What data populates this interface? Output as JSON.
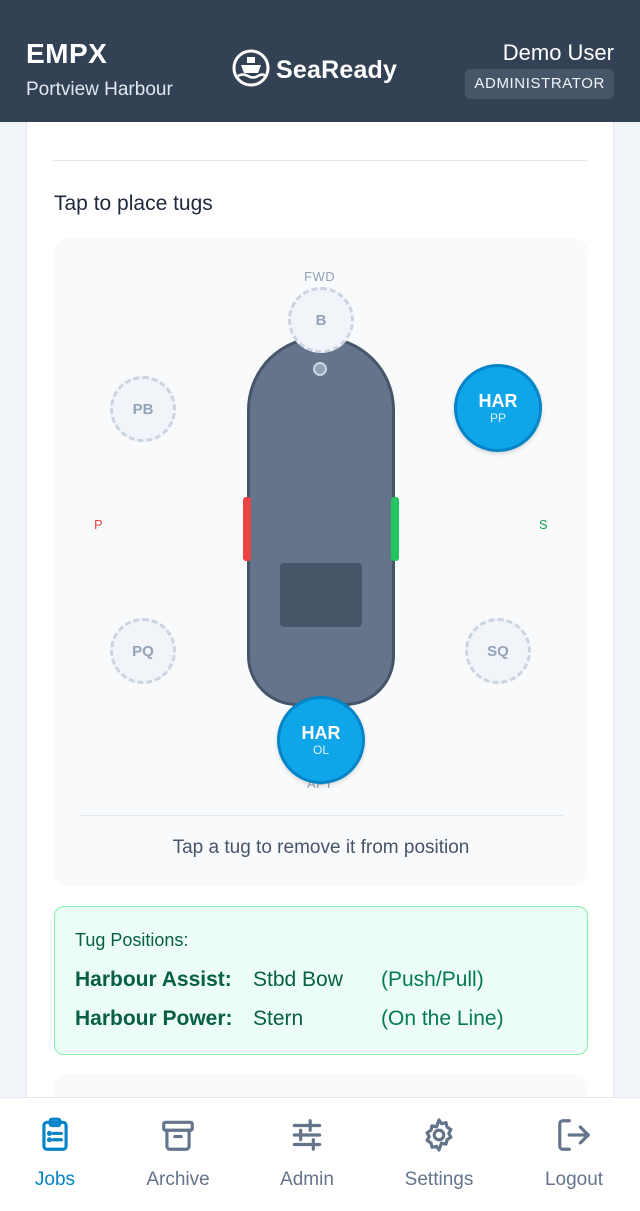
{
  "header": {
    "vessel_code": "EMPX",
    "port": "Portview Harbour",
    "brand": "SeaReady",
    "user_name": "Demo User",
    "user_role": "ADMINISTRATOR"
  },
  "section": {
    "title": "Tap to place tugs"
  },
  "diagram": {
    "fwd_label": "FWD",
    "aft_label": "AFT",
    "port_label": "P",
    "stbd_label": "S",
    "slots": {
      "b": "B",
      "pb": "PB",
      "pq": "PQ",
      "sq": "SQ"
    },
    "tugs": [
      {
        "code": "HAR",
        "position": "PP"
      },
      {
        "code": "HAR",
        "position": "OL"
      }
    ],
    "hint": "Tap a tug to remove it from position"
  },
  "positions": {
    "title": "Tug Positions:",
    "rows": [
      {
        "name": "Harbour Assist:",
        "where": "Stbd Bow",
        "mode": "(Push/Pull)"
      },
      {
        "name": "Harbour Power:",
        "where": "Stern",
        "mode": "(On the Line)"
      }
    ]
  },
  "nav": {
    "items": [
      {
        "label": "Jobs",
        "icon": "clipboard-icon",
        "active": true
      },
      {
        "label": "Archive",
        "icon": "archive-icon"
      },
      {
        "label": "Admin",
        "icon": "sliders-icon"
      },
      {
        "label": "Settings",
        "icon": "gear-icon"
      },
      {
        "label": "Logout",
        "icon": "logout-icon"
      }
    ]
  },
  "colors": {
    "header_bg": "#334155",
    "accent": "#0284c7",
    "tug_fill": "#0ea5e9",
    "port": "#ef4444",
    "starboard": "#22c55e"
  }
}
